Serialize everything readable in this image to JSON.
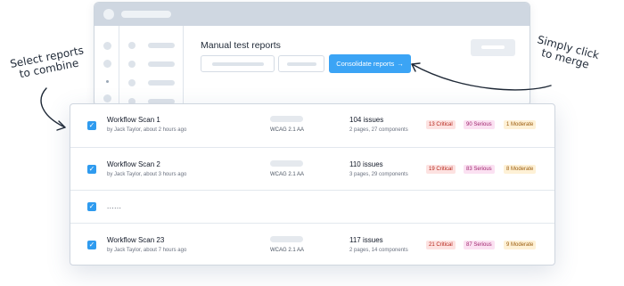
{
  "window": {
    "title": "Manual test reports",
    "consolidate_label": "Consolidate reports",
    "consolidate_arrow": "→"
  },
  "annotations": {
    "left_line1": "Select reports",
    "left_line2": "to combine",
    "right_line1": "Simply click",
    "right_line2": "to merge"
  },
  "reports": [
    {
      "checked": true,
      "name": "Workflow Scan 1",
      "meta": "by Jack Taylor, about 2 hours ago",
      "standard": "WCAG 2.1 AA",
      "issues": "104 issues",
      "pages": "2 pages, 27 components",
      "critical": "13 Critical",
      "serious": "90 Serious",
      "moderate": "1 Moderate"
    },
    {
      "checked": true,
      "name": "Workflow Scan 2",
      "meta": "by Jack Taylor, about 3 hours ago",
      "standard": "WCAG 2.1 AA",
      "issues": "110 issues",
      "pages": "3 pages, 29 components",
      "critical": "19 Critical",
      "serious": "83 Serious",
      "moderate": "8 Moderate"
    },
    {
      "checked": true,
      "name": "......"
    },
    {
      "checked": true,
      "name": "Workflow Scan 23",
      "meta": "by Jack Taylor, about 7 hours ago",
      "standard": "WCAG 2.1 AA",
      "issues": "117 issues",
      "pages": "2 pages, 14 components",
      "critical": "21 Critical",
      "serious": "87 Serious",
      "moderate": "9 Moderate"
    }
  ],
  "colors": {
    "accent": "#3ba4f5",
    "critical_bg": "#fde2e1",
    "serious_bg": "#fbe1f2",
    "moderate_bg": "#fef1d6"
  }
}
